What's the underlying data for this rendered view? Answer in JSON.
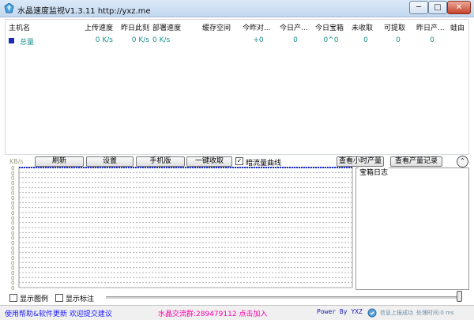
{
  "window": {
    "title": "水晶速度监视V1.3.11 http://yxz.me",
    "min_label": "─",
    "max_label": "□",
    "close_label": "✕"
  },
  "table": {
    "headers": [
      "主机名",
      "上传速度",
      "昨日此刻",
      "部署速度",
      "缓存空间",
      "今昨对...",
      "今日产...",
      "今日宝箱",
      "未收取",
      "可提取",
      "昨日产...",
      "蛙由"
    ],
    "total_row": {
      "name": "总量",
      "upload": "0 K/s",
      "yesterday_now": "0 K/s",
      "deploy": "0 K/s",
      "cache": "",
      "compare": "+0",
      "today_output": "0",
      "today_box": "0^0",
      "uncollected": "0",
      "withdrawable": "0",
      "yesterday_output": "0",
      "extra": ""
    }
  },
  "toolbar": {
    "unit": "KB/s",
    "refresh": "刷新",
    "settings": "设置",
    "mobile": "手机版",
    "collect_all": "一键收取",
    "traffic_curve": "暗流量曲线",
    "traffic_checked": "✓",
    "hourly": "查看小时产量",
    "records": "查看产量记录",
    "collapse": "⌃"
  },
  "chart": {
    "y_tick_label": "0",
    "row_count": 24,
    "baseline_color": "#1a2bd6"
  },
  "log_panel": {
    "title": "宝箱日志"
  },
  "options": {
    "show_legend": "显示图例",
    "show_mark": "显示标注"
  },
  "status": {
    "help": "使用帮助&软件更新  欢迎提交建议",
    "group": "水晶交流群:289479112  点击加入",
    "power": "Power By YXZ",
    "info": "信息上报成功",
    "info2": "处理时间:0 ms"
  },
  "colors": {
    "accent_cyan": "#1b8f8f",
    "marker_blue": "#1a2bbf",
    "link_blue": "#1a1aff",
    "pink": "#ff00aa"
  }
}
